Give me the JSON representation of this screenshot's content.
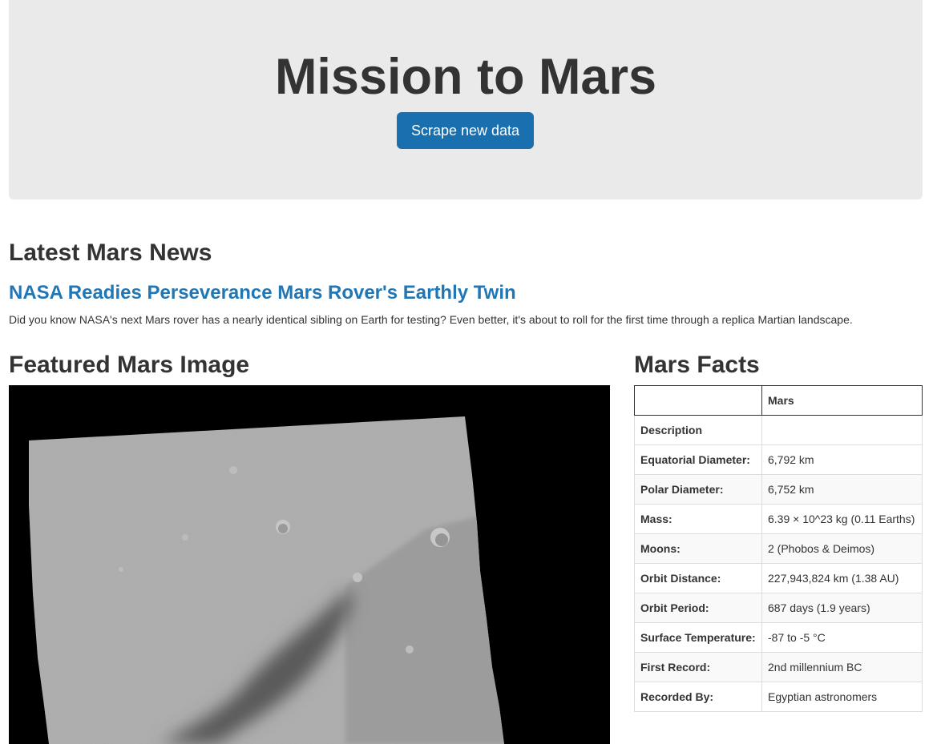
{
  "header": {
    "title": "Mission to Mars",
    "scrape_button_label": "Scrape new data"
  },
  "news": {
    "heading": "Latest Mars News",
    "title": "NASA Readies Perseverance Mars Rover's Earthly Twin",
    "teaser": "Did you know NASA's next Mars rover has a nearly identical sibling on Earth for testing? Even better, it's about to roll for the first time through a replica Martian landscape."
  },
  "featured_image": {
    "heading": "Featured Mars Image"
  },
  "facts": {
    "heading": "Mars Facts",
    "columns": [
      "",
      "Mars"
    ],
    "rows": [
      {
        "label": "Description",
        "value": ""
      },
      {
        "label": "Equatorial Diameter:",
        "value": "6,792 km"
      },
      {
        "label": "Polar Diameter:",
        "value": "6,752 km"
      },
      {
        "label": "Mass:",
        "value": "6.39 × 10^23 kg (0.11 Earths)"
      },
      {
        "label": "Moons:",
        "value": "2 (Phobos & Deimos)"
      },
      {
        "label": "Orbit Distance:",
        "value": "227,943,824 km (1.38 AU)"
      },
      {
        "label": "Orbit Period:",
        "value": "687 days (1.9 years)"
      },
      {
        "label": "Surface Temperature:",
        "value": "-87 to -5 °C"
      },
      {
        "label": "First Record:",
        "value": "2nd millennium BC"
      },
      {
        "label": "Recorded By:",
        "value": "Egyptian astronomers"
      }
    ]
  }
}
